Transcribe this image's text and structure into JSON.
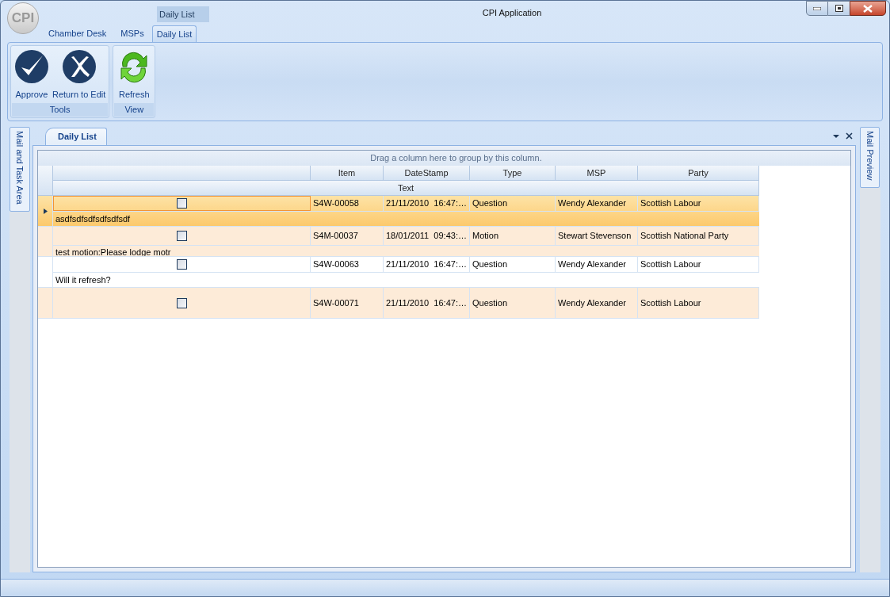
{
  "window": {
    "title": "CPI Application",
    "logo": "CPI",
    "quick_access_tab": "Daily List"
  },
  "ribbon": {
    "tabs": [
      {
        "label": "Chamber Desk",
        "selected": false
      },
      {
        "label": "MSPs",
        "selected": false
      },
      {
        "label": "Daily List",
        "selected": true
      }
    ],
    "groups": [
      {
        "label": "Tools",
        "buttons": [
          {
            "label": "Approve",
            "kind": "approve"
          },
          {
            "label": "Return to Edit",
            "kind": "return"
          }
        ]
      },
      {
        "label": "View",
        "buttons": [
          {
            "label": "Refresh",
            "kind": "refresh"
          }
        ]
      }
    ]
  },
  "left_panel": {
    "label": "Mail and Task Area"
  },
  "right_panel": {
    "label": "Mail Preview"
  },
  "document": {
    "tab": "Daily List",
    "group_hint": "Drag a column here to group by this column.",
    "columns": [
      "Item",
      "DateStamp",
      "Type",
      "MSP",
      "Party"
    ],
    "text_column": "Text",
    "rows": [
      {
        "selected": true,
        "checked": false,
        "item": "S4W-00058",
        "datestamp": "21/11/2010  16:47:…",
        "type": "Question",
        "msp": "Wendy Alexander",
        "party": "Scottish Labour",
        "text": "asdfsdfsdfsdfsdfsdf"
      },
      {
        "selected": false,
        "checked": false,
        "item": "S4M-00037",
        "datestamp": "18/01/2011  09:43:…",
        "type": "Motion",
        "msp": "Stewart Stevenson",
        "party": "Scottish National Party",
        "text": "test motion:Please lodge motr"
      },
      {
        "selected": false,
        "checked": false,
        "item": "S4W-00063",
        "datestamp": "21/11/2010  16:47:…",
        "type": "Question",
        "msp": "Wendy Alexander",
        "party": "Scottish Labour",
        "text": "Will it refresh?"
      },
      {
        "selected": false,
        "checked": false,
        "item": "S4W-00071",
        "datestamp": "21/11/2010  16:47:…",
        "type": "Question",
        "msp": "Wendy Alexander",
        "party": "Scottish Labour"
      }
    ]
  }
}
